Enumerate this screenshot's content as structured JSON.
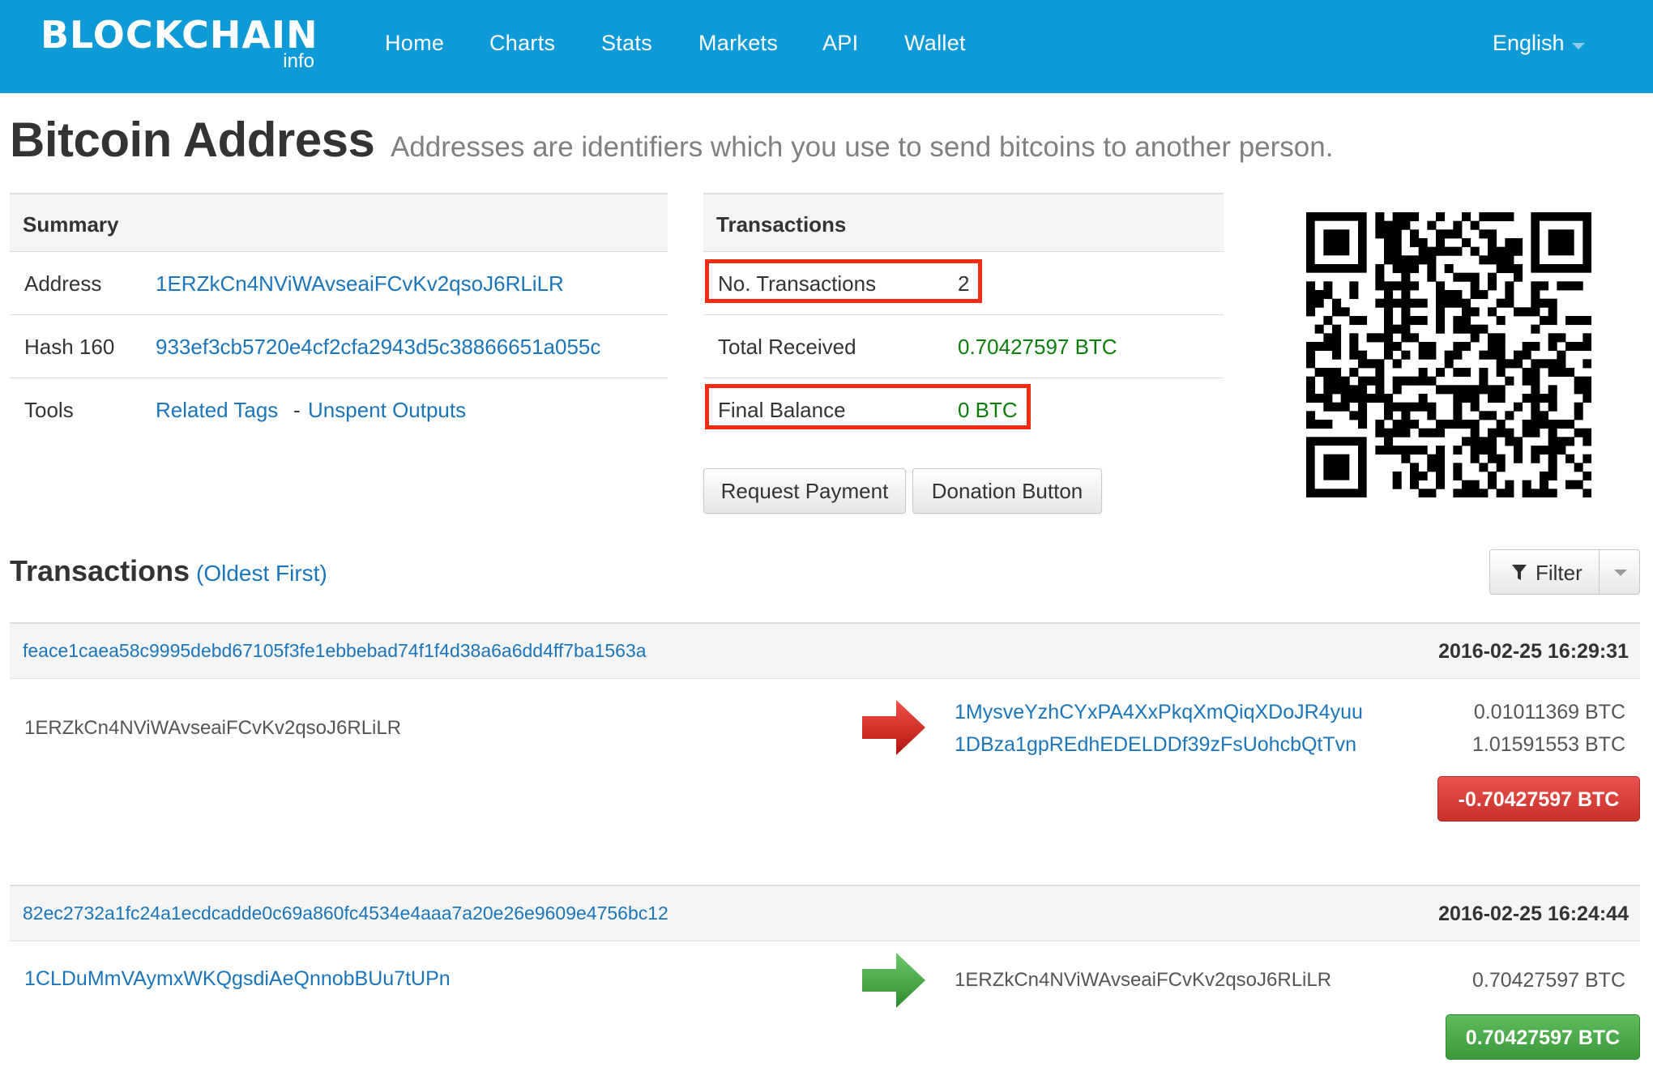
{
  "navbar": {
    "logo": "BLOCKCHAIN",
    "logo_sub": "info",
    "items": [
      {
        "label": "Home"
      },
      {
        "label": "Charts"
      },
      {
        "label": "Stats"
      },
      {
        "label": "Markets"
      },
      {
        "label": "API"
      },
      {
        "label": "Wallet"
      }
    ],
    "language": "English",
    "bg_color": "#0d9ad6"
  },
  "page": {
    "title": "Bitcoin Address",
    "subtitle": "Addresses are identifiers which you use to send bitcoins to another person."
  },
  "summary": {
    "header": "Summary",
    "address_label": "Address",
    "address": "1ERZkCn4NViWAvseaiFCvKv2qsoJ6RLiLR",
    "hash_label": "Hash 160",
    "hash": "933ef3cb5720e4cf2cfa2943d5c38866651a055c",
    "tools_label": "Tools",
    "tool_related": "Related Tags",
    "tool_sep": "-",
    "tool_unspent": "Unspent Outputs"
  },
  "transactions_panel": {
    "header": "Transactions",
    "count_label": "No. Transactions",
    "count": "2",
    "received_label": "Total Received",
    "received": "0.70427597 BTC",
    "balance_label": "Final Balance",
    "balance": "0 BTC",
    "request_button": "Request Payment",
    "donation_button": "Donation Button",
    "highlight_color": "#f02d10"
  },
  "tx_list": {
    "heading": "Transactions",
    "order": "(Oldest First)",
    "filter_label": "Filter",
    "items": [
      {
        "hash": "feace1caea58c9995debd67105f3fe1ebbebad74f1f4d38a6a6dd4ff7ba1563a",
        "time": "2016-02-25 16:29:31",
        "input": "1ERZkCn4NViWAvseaiFCvKv2qsoJ6RLiLR",
        "outputs": [
          {
            "address": "1MysveYzhCYxPA4XxPkqXmQiqXDoJR4yuu",
            "amount": "0.01011369 BTC"
          },
          {
            "address": "1DBza1gpREdhEDELDDf39zFsUohcbQtTvn",
            "amount": "1.01591553 BTC"
          }
        ],
        "result": "-0.70427597 BTC",
        "direction": "outgoing",
        "arrow_color": "#d0201b"
      },
      {
        "hash": "82ec2732a1fc24a1ecdcadde0c69a860fc4534e4aaa7a20e26e9609e4756bc12",
        "time": "2016-02-25 16:24:44",
        "input": "1CLDuMmVAymxWKQgsdiAeQnnobBUu7tUPn",
        "outputs": [
          {
            "address": "1ERZkCn4NViWAvseaiFCvKv2qsoJ6RLiLR",
            "amount": "0.70427597 BTC"
          }
        ],
        "result": "0.70427597 BTC",
        "direction": "incoming",
        "arrow_color": "#3faa3f"
      }
    ]
  },
  "icons": {
    "filter": "funnel-icon",
    "caret": "caret-down-icon",
    "arrow": "right-arrow-icon",
    "qr": "qr-code"
  }
}
